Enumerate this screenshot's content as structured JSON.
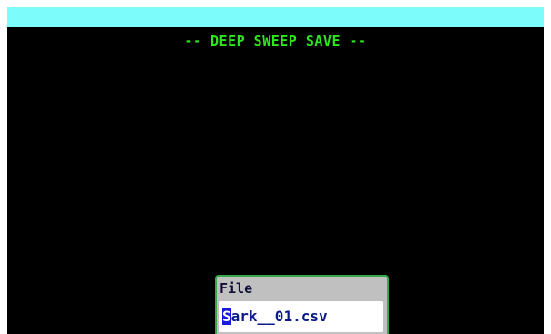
{
  "screen": {
    "title": "-- DEEP SWEEP SAVE --"
  },
  "file_dialog": {
    "label": "File",
    "value_cursor_char": "S",
    "value_rest": "ark__01.csv"
  },
  "colors": {
    "top_bar": "#7dfcfc",
    "background": "#000000",
    "title_text": "#2ee51e",
    "dialog_bg": "#c0c0c0",
    "dialog_border": "#3aa84a",
    "input_text": "#0a1a8a",
    "cursor_bg": "#1a1adf"
  }
}
